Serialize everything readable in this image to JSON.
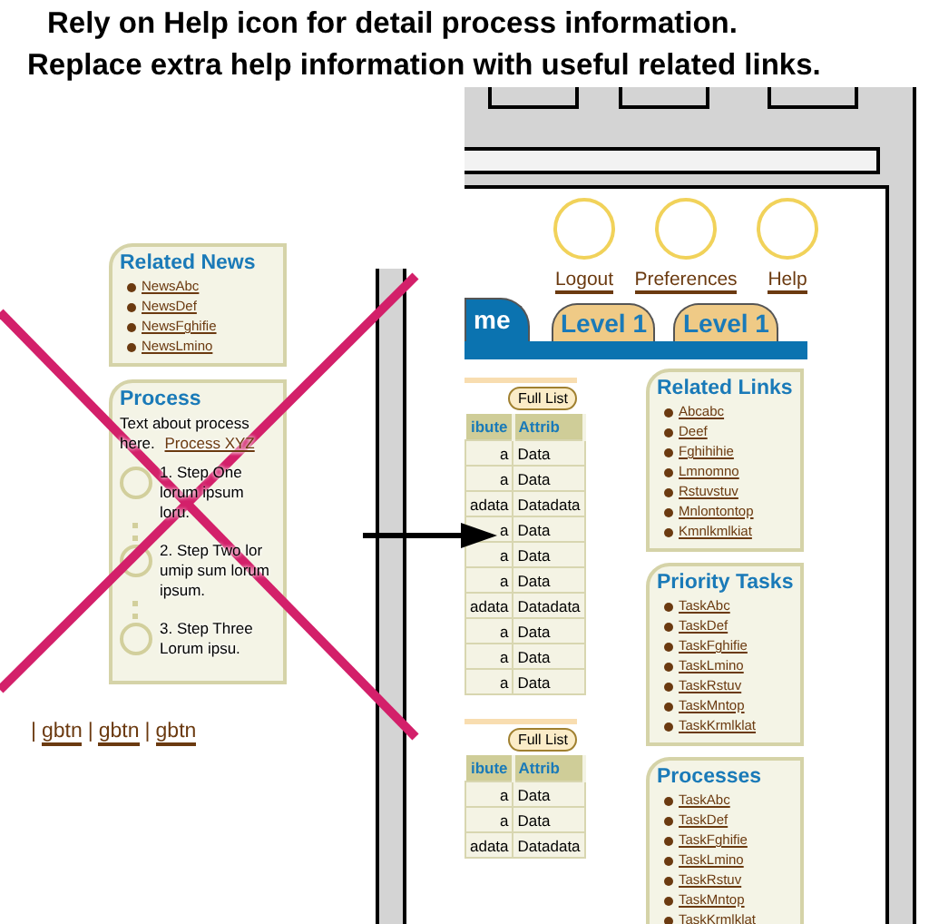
{
  "captions": [
    "Rely on Help icon for detail process information.",
    "Replace extra help information with useful related links."
  ],
  "old_panel": {
    "crossed_out": true,
    "related_news": {
      "title": "Related News",
      "links": [
        "NewsAbc",
        "NewsDef",
        "NewsFghifie",
        "NewsLmino"
      ]
    },
    "process": {
      "title": "Process",
      "text": "Text about process here.",
      "link": "Process XYZ",
      "steps": [
        "1. Step One lorum ipsum loru.",
        "2. Step Two lor umip sum lorum ipsum.",
        "3. Step Three Lorum ipsu."
      ]
    },
    "footer": [
      {
        "kind": "separator",
        "text": "|"
      },
      {
        "kind": "link",
        "text": "gbtn"
      },
      {
        "kind": "separator",
        "text": "|"
      },
      {
        "kind": "link",
        "text": "gbtn"
      },
      {
        "kind": "separator",
        "text": "|"
      },
      {
        "kind": "link",
        "text": "gbtn"
      }
    ]
  },
  "new_screen": {
    "header_links": [
      "Logout",
      "Preferences",
      "Help"
    ],
    "tabs": [
      {
        "label": "me",
        "selected": true
      },
      {
        "label": "Level 1",
        "selected": false
      },
      {
        "label": "Level 1",
        "selected": false
      }
    ],
    "tables": [
      {
        "button": "Full List",
        "columns": [
          "ibute",
          "Attrib"
        ],
        "rows": [
          [
            "a",
            "Data"
          ],
          [
            "a",
            "Data"
          ],
          [
            "adata",
            "Datadata"
          ],
          [
            "a",
            "Data"
          ],
          [
            "a",
            "Data"
          ],
          [
            "a",
            "Data"
          ],
          [
            "adata",
            "Datadata"
          ],
          [
            "a",
            "Data"
          ],
          [
            "a",
            "Data"
          ],
          [
            "a",
            "Data"
          ]
        ]
      },
      {
        "button": "Full List",
        "columns": [
          "ibute",
          "Attrib"
        ],
        "rows": [
          [
            "a",
            "Data"
          ],
          [
            "a",
            "Data"
          ],
          [
            "adata",
            "Datadata"
          ]
        ]
      }
    ],
    "boxes": [
      {
        "title": "Related Links",
        "links": [
          "Abcabc",
          "Deef",
          "Fghihihie",
          "Lmnomno",
          "Rstuvstuv",
          "Mnlontontop",
          "Kmnlkmlkiat"
        ]
      },
      {
        "title": "Priority Tasks",
        "links": [
          "TaskAbc",
          "TaskDef",
          "TaskFghifie",
          "TaskLmino",
          "TaskRstuv",
          "TaskMntop",
          "TaskKrmlklat"
        ]
      },
      {
        "title": "Processes",
        "links": [
          "TaskAbc",
          "TaskDef",
          "TaskFghifie",
          "TaskLmino",
          "TaskRstuv",
          "TaskMntop",
          "TaskKrmlklat"
        ]
      }
    ]
  }
}
